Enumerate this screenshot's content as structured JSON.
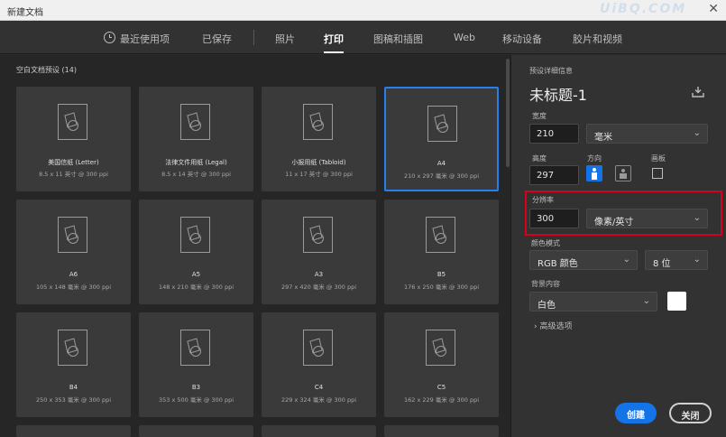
{
  "window": {
    "title": "新建文档",
    "close_glyph": "✕",
    "watermark": "UiBQ.COM"
  },
  "tabs": [
    {
      "label": "最近使用项",
      "icon": "clock-icon"
    },
    {
      "label": "已保存"
    },
    {
      "label": "照片"
    },
    {
      "label": "打印",
      "active": true
    },
    {
      "label": "图稿和插图"
    },
    {
      "label": "Web"
    },
    {
      "label": "移动设备"
    },
    {
      "label": "胶片和视频"
    }
  ],
  "presets": {
    "title": "空白文档预设 (14)",
    "items": [
      {
        "name": "美国信纸 (Letter)",
        "spec": "8.5 x 11 英寸 @ 300 ppi"
      },
      {
        "name": "法律文件用纸 (Legal)",
        "spec": "8.5 x 14 英寸 @ 300 ppi"
      },
      {
        "name": "小报用纸 (Tabloid)",
        "spec": "11 x 17 英寸 @ 300 ppi"
      },
      {
        "name": "A4",
        "spec": "210 x 297 毫米 @ 300 ppi",
        "selected": true
      },
      {
        "name": "A6",
        "spec": "105 x 148 毫米 @ 300 ppi"
      },
      {
        "name": "A5",
        "spec": "148 x 210 毫米 @ 300 ppi"
      },
      {
        "name": "A3",
        "spec": "297 x 420 毫米 @ 300 ppi"
      },
      {
        "name": "B5",
        "spec": "176 x 250 毫米 @ 300 ppi"
      },
      {
        "name": "B4",
        "spec": "250 x 353 毫米 @ 300 ppi"
      },
      {
        "name": "B3",
        "spec": "353 x 500 毫米 @ 300 ppi"
      },
      {
        "name": "C4",
        "spec": "229 x 324 毫米 @ 300 ppi"
      },
      {
        "name": "C5",
        "spec": "162 x 229 毫米 @ 300 ppi"
      }
    ]
  },
  "details": {
    "heading": "预设详细信息",
    "doc_name": "未标题-1",
    "width_label": "宽度",
    "width_value": "210",
    "width_unit": "毫米",
    "height_label": "高度",
    "height_value": "297",
    "orientation_label": "方向",
    "artboard_label": "画板",
    "resolution_label": "分辨率",
    "resolution_value": "300",
    "resolution_unit": "像素/英寸",
    "color_mode_label": "颜色模式",
    "color_mode_value": "RGB 颜色",
    "bit_depth_value": "8 位",
    "background_label": "背景内容",
    "background_value": "白色",
    "advanced_label": "高级选项",
    "chevron_glyph": "⌄",
    "advanced_glyph": "›"
  },
  "buttons": {
    "create": "创建",
    "close": "关闭"
  },
  "colors": {
    "accent": "#1473e6",
    "selection": "#2680eb",
    "highlight": "#d9001b"
  }
}
